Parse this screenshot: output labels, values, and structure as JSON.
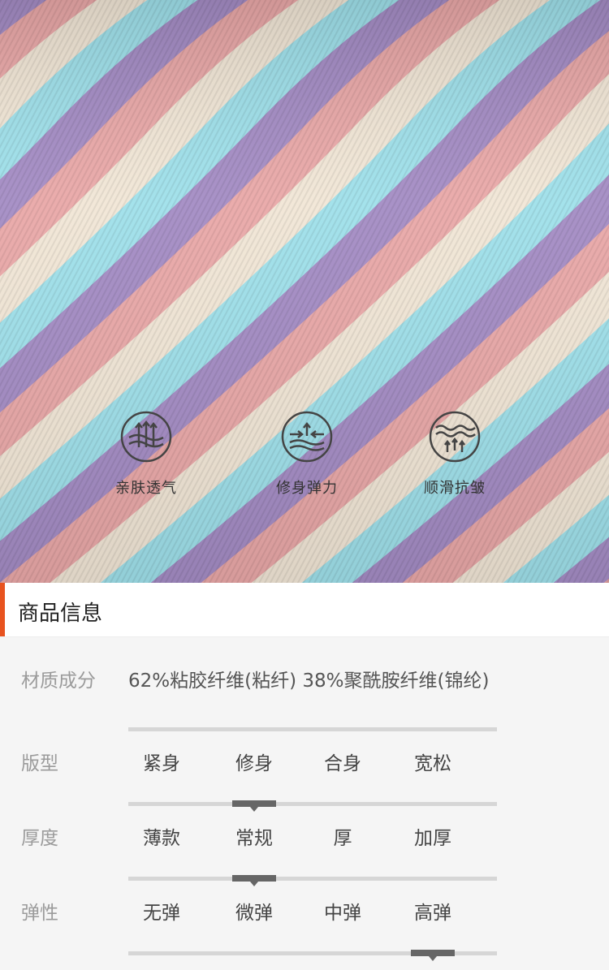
{
  "features": [
    {
      "icon": "breathable-arrows-icon",
      "label": "亲肤透气"
    },
    {
      "icon": "stretch-arrows-icon",
      "label": "修身弹力"
    },
    {
      "icon": "anti-wrinkle-waves-icon",
      "label": "顺滑抗皱"
    }
  ],
  "section": {
    "title": "商品信息"
  },
  "material": {
    "label": "材质成分",
    "value": "62%粘胶纤维(粘纤) 38%聚酰胺纤维(锦纶)"
  },
  "attributes": [
    {
      "label": "版型",
      "options": [
        "紧身",
        "修身",
        "合身",
        "宽松"
      ],
      "selected_index": 1
    },
    {
      "label": "厚度",
      "options": [
        "薄款",
        "常规",
        "厚",
        "加厚"
      ],
      "selected_index": 1
    },
    {
      "label": "弹性",
      "options": [
        "无弹",
        "微弹",
        "中弹",
        "高弹"
      ],
      "selected_index": 3
    }
  ],
  "colors": {
    "accent": "#e8531f",
    "stripes": [
      "#e9a8a8",
      "#f1e6d6",
      "#9fe0ea",
      "#a48cc4"
    ]
  }
}
